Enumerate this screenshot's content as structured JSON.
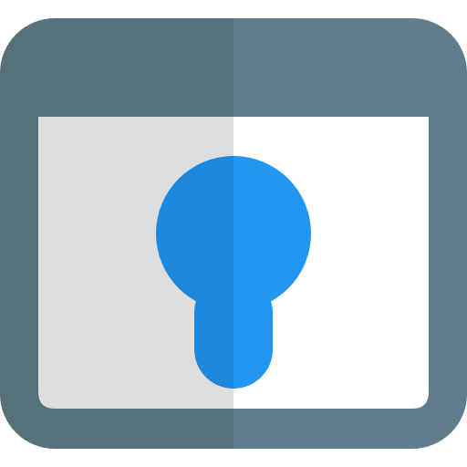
{
  "icon": {
    "name": "browser-keyhole-icon",
    "colors": {
      "frame_left": "#56707C",
      "frame_right": "#607D8B",
      "content_left": "#DEDEDE",
      "content_right": "#FFFFFF",
      "keyhole_left": "#1E88DD",
      "keyhole_right": "#2196F3"
    }
  }
}
